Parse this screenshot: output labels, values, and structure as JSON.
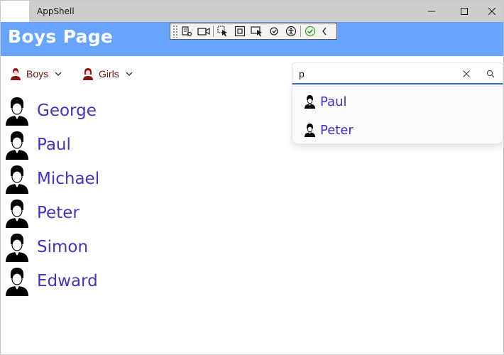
{
  "window": {
    "title": "AppShell"
  },
  "header": {
    "title": "Boys Page"
  },
  "nav": {
    "items": [
      {
        "label": "Boys"
      },
      {
        "label": "Girls"
      }
    ]
  },
  "search": {
    "value": "p",
    "placeholder": ""
  },
  "suggestions": [
    {
      "label": "Paul"
    },
    {
      "label": "Peter"
    }
  ],
  "boys": [
    {
      "name": "George"
    },
    {
      "name": "Paul"
    },
    {
      "name": "Michael"
    },
    {
      "name": "Peter"
    },
    {
      "name": "Simon"
    },
    {
      "name": "Edward"
    }
  ],
  "colors": {
    "header": "#67a4ff",
    "name_text": "#4b2fc4",
    "nav_text": "#6b1010",
    "accent": "#2a6fc1"
  }
}
